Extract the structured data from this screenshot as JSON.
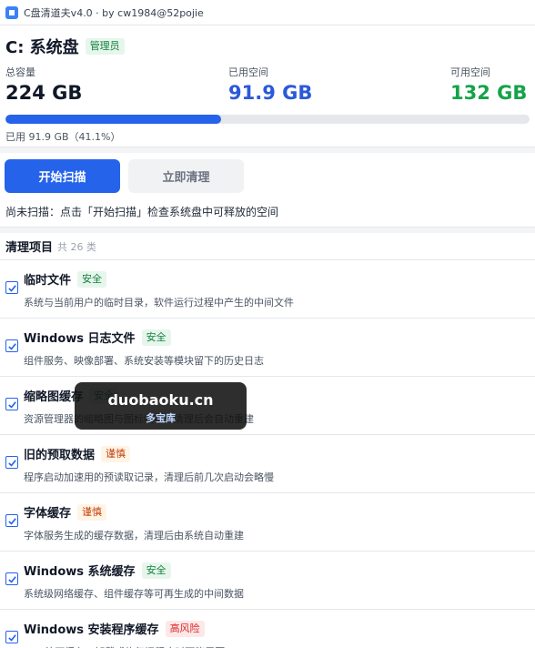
{
  "window": {
    "title": "C盘清道夫v4.0 · by cw1984@52pojie"
  },
  "disk": {
    "title": "C: 系统盘",
    "role_badge": "管理员",
    "total_label": "总容量",
    "total_value": "224 GB",
    "used_label": "已用空间",
    "used_value": "91.9 GB",
    "free_label": "可用空间",
    "free_value": "132 GB",
    "usage_fraction": 0.411,
    "usage_text": "已用 91.9 GB（41.1%）"
  },
  "actions": {
    "scan_label": "开始扫描",
    "clean_label": "立即清理",
    "status_text": "尚未扫描：点击「开始扫描」检查系统盘中可释放的空间"
  },
  "list": {
    "heading": "清理项目",
    "count_text": "共 26 类",
    "items": [
      {
        "name": "临时文件",
        "badge": "安全",
        "risk": "safe",
        "desc": "系统与当前用户的临时目录，软件运行过程中产生的中间文件",
        "checked": true
      },
      {
        "name": "Windows 日志文件",
        "badge": "安全",
        "risk": "safe",
        "desc": "组件服务、映像部署、系统安装等模块留下的历史日志",
        "checked": true
      },
      {
        "name": "缩略图缓存",
        "badge": "安全",
        "risk": "safe",
        "desc": "资源管理器的缩略图与图标缓存，清理后会自动重建",
        "checked": true
      },
      {
        "name": "旧的预取数据",
        "badge": "谨慎",
        "risk": "caution",
        "desc": "程序启动加速用的预读取记录，清理后前几次启动会略慢",
        "checked": true
      },
      {
        "name": "字体缓存",
        "badge": "谨慎",
        "risk": "caution",
        "desc": "字体服务生成的缓存数据，清理后由系统自动重建",
        "checked": true
      },
      {
        "name": "Windows 系统缓存",
        "badge": "安全",
        "risk": "safe",
        "desc": "系统级网络缓存、组件缓存等可再生成的中间数据",
        "checked": true
      },
      {
        "name": "Windows 安装程序缓存",
        "badge": "高风险",
        "risk": "high",
        "desc": "MSI 补丁缓存，卸载或修复旧程序时可能需要",
        "checked": true
      }
    ]
  },
  "watermark": {
    "main": "duobaoku.cn",
    "sub": "多宝库"
  },
  "colors": {
    "accent": "#2563eb",
    "used": "#2b59d9",
    "free": "#16a34a",
    "safe": "#15803d",
    "caution": "#c2410c",
    "high": "#dc2626"
  }
}
